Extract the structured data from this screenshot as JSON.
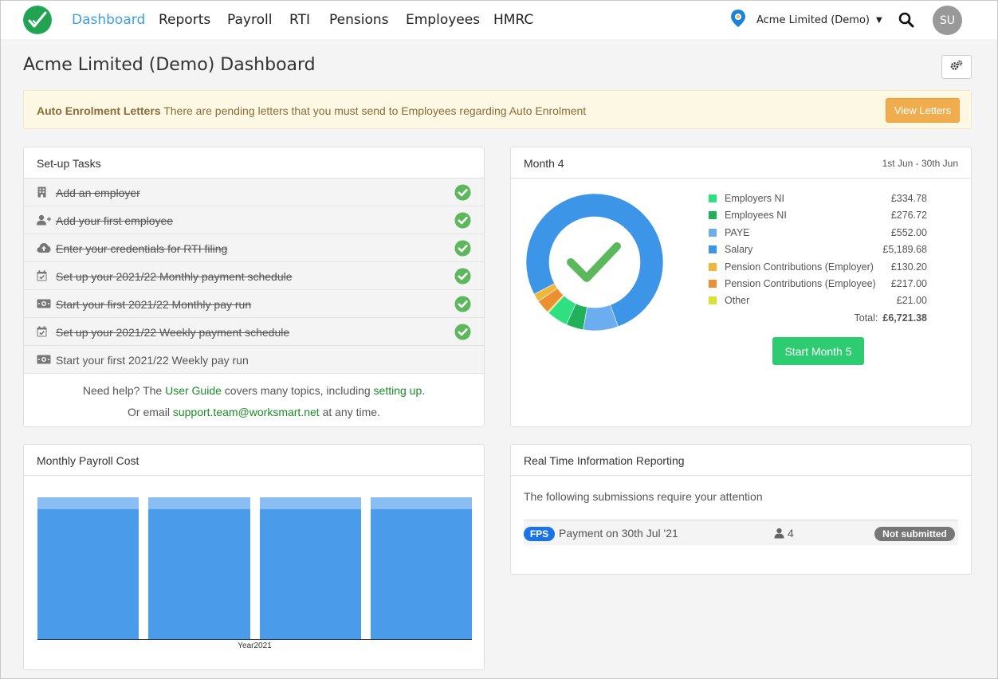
{
  "nav": {
    "links": [
      "Dashboard",
      "Reports",
      "Payroll",
      "RTI",
      "Pensions",
      "Employees",
      "HMRC"
    ],
    "active": "Dashboard",
    "company": "Acme Limited (Demo)",
    "avatar_initials": "SU"
  },
  "page": {
    "title": "Acme Limited (Demo) Dashboard"
  },
  "alert": {
    "heading": "Auto Enrolment Letters",
    "message": "There are pending letters that you must send to Employees regarding Auto Enrolment",
    "button": "View Letters"
  },
  "setup": {
    "title": "Set-up Tasks",
    "tasks": [
      {
        "label": "Add an employer",
        "icon": "building-icon",
        "done": true
      },
      {
        "label": "Add your first employee",
        "icon": "add-user-icon",
        "done": true
      },
      {
        "label": "Enter your credentials for RTI filing",
        "icon": "cloud-upload-icon",
        "done": true
      },
      {
        "label": "Set up your 2021/22 Monthly payment schedule",
        "icon": "calendar-check-icon",
        "done": true
      },
      {
        "label": "Start your first 2021/22 Monthly pay run",
        "icon": "money-icon",
        "done": true
      },
      {
        "label": "Set up your 2021/22 Weekly payment schedule",
        "icon": "calendar-check-icon",
        "done": true
      },
      {
        "label": "Start your first 2021/22 Weekly pay run",
        "icon": "money-icon",
        "done": false
      }
    ],
    "help1_pre": "Need help? The ",
    "help1_link1": "User Guide",
    "help1_mid": " covers many topics, including ",
    "help1_link2": "setting up",
    "help1_post": ".",
    "help2_pre": "Or email ",
    "help2_link": "support.team@worksmart.net",
    "help2_post": " at any time."
  },
  "month": {
    "title": "Month 4",
    "range": "1st Jun - 30th Jun",
    "items": [
      {
        "label": "Employers NI",
        "value": "£334.78",
        "amount": 334.78,
        "color": "#2ee07f"
      },
      {
        "label": "Employees NI",
        "value": "£276.72",
        "amount": 276.72,
        "color": "#21b15a"
      },
      {
        "label": "PAYE",
        "value": "£552.00",
        "amount": 552.0,
        "color": "#6aaef0"
      },
      {
        "label": "Salary",
        "value": "£5,189.68",
        "amount": 5189.68,
        "color": "#3d95e8"
      },
      {
        "label": "Pension Contributions (Employer)",
        "value": "£130.20",
        "amount": 130.2,
        "color": "#f0b73a"
      },
      {
        "label": "Pension Contributions (Employee)",
        "value": "£217.00",
        "amount": 217.0,
        "color": "#eb8f2f"
      },
      {
        "label": "Other",
        "value": "£21.00",
        "amount": 21.0,
        "color": "#d7e236"
      }
    ],
    "total_label": "Total:",
    "total_value": "£6,721.38",
    "button": "Start Month 5"
  },
  "payroll_cost": {
    "title": "Monthly Payroll Cost"
  },
  "chart_data": {
    "type": "bar",
    "categories": [
      "",
      "",
      "",
      ""
    ],
    "xlabel": "Year2021",
    "series": [
      {
        "values": [
          6159.68,
          6159.68,
          6159.68,
          6159.68
        ],
        "color": "#4a9be9"
      },
      {
        "values": [
          561.7,
          561.7,
          561.7,
          561.7
        ],
        "color": "#8abdf2"
      }
    ],
    "ylim": [
      0,
      6721.38
    ]
  },
  "rti": {
    "title": "Real Time Information Reporting",
    "message": "The following submissions require your attention",
    "submission": {
      "badge": "FPS",
      "text": "Payment on 30th Jul '21",
      "employees": "4",
      "status": "Not submitted"
    }
  },
  "colors": {
    "accent": "#3d9fe0",
    "success": "#2ecc71",
    "warning": "#f0ad4e",
    "check_green": "#5cb85c"
  }
}
